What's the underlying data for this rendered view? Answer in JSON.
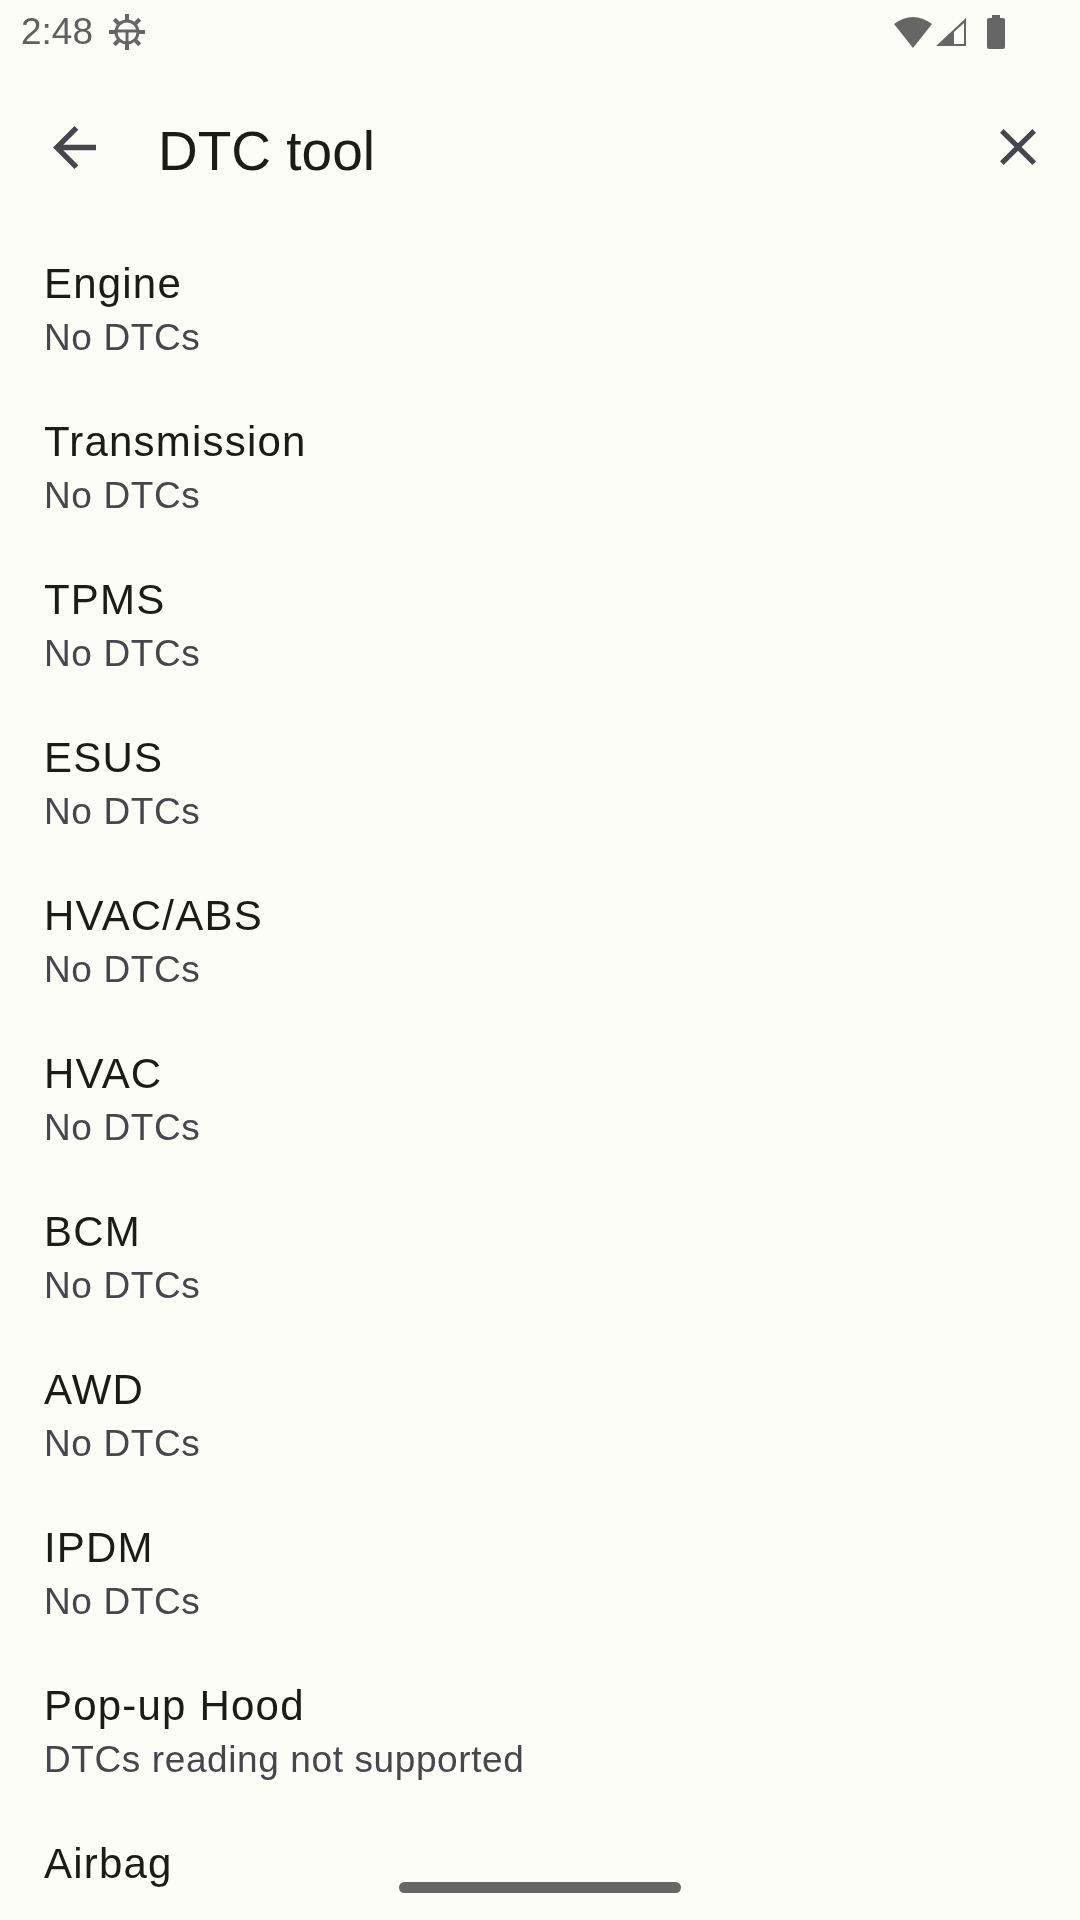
{
  "status_bar": {
    "time": "2:48"
  },
  "app_bar": {
    "title": "DTC tool"
  },
  "modules": [
    {
      "name": "Engine",
      "status": "No DTCs"
    },
    {
      "name": "Transmission",
      "status": "No DTCs"
    },
    {
      "name": "TPMS",
      "status": "No DTCs"
    },
    {
      "name": "ESUS",
      "status": "No DTCs"
    },
    {
      "name": "HVAC/ABS",
      "status": "No DTCs"
    },
    {
      "name": "HVAC",
      "status": "No DTCs"
    },
    {
      "name": "BCM",
      "status": "No DTCs"
    },
    {
      "name": "AWD",
      "status": "No DTCs"
    },
    {
      "name": "IPDM",
      "status": "No DTCs"
    },
    {
      "name": "Pop-up Hood",
      "status": "DTCs reading not supported"
    },
    {
      "name": "Airbag"
    }
  ]
}
